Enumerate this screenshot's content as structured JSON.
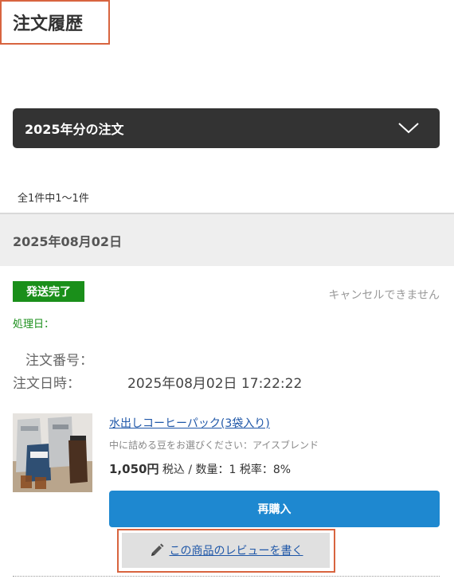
{
  "page": {
    "title": "注文履歴"
  },
  "filter": {
    "year_label": "2025年分の注文",
    "count_text": "全1件中1～1件"
  },
  "order": {
    "date_header": "2025年08月02日",
    "status": "発送完了",
    "status_color": "#1a8f1a",
    "cancel_note": "キャンセルできません",
    "process_date_label": "処理日：",
    "order_number_label": "注文番号：",
    "order_datetime_label": "注文日時：",
    "order_datetime_value": "2025年08月02日 17:22:22",
    "item": {
      "name": "水出しコーヒーパック(3袋入り)",
      "option": "中に詰める豆をお選びください：アイスブレンド",
      "price": "1,050円",
      "price_detail": "税込 / 数量：1 税率：8%",
      "image_icon": "coffee-product-photo"
    },
    "rebuy_label": "再購入",
    "review_label": "この商品のレビューを書く",
    "review_icon": "pencil-icon"
  },
  "colors": {
    "accent_blue": "#1e88d0",
    "highlight_orange": "#d8643f",
    "dark_select": "#333333"
  }
}
